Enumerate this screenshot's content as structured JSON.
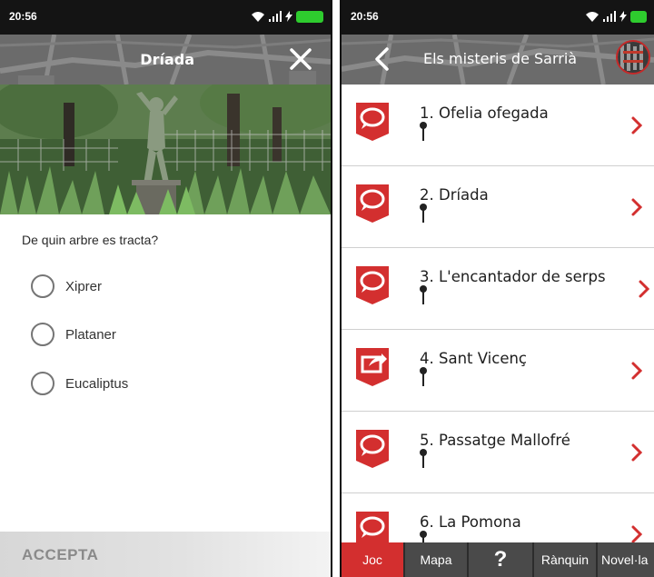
{
  "left_screen": {
    "status_time": "20:56",
    "header_title": "Dríada",
    "close_icon": "close-icon",
    "question": "De quin arbre es tracta?",
    "options": [
      "Xiprer",
      "Plataner",
      "Eucaliptus"
    ],
    "accept_label": "ACCEPTA"
  },
  "right_screen": {
    "status_time": "20:56",
    "header_title": "Els misteris de Sarrià",
    "back_icon": "back-arrow-icon",
    "items": [
      {
        "title": "1. Ofelia ofegada",
        "icon": "speech-bubble-icon"
      },
      {
        "title": "2. Dríada",
        "icon": "speech-bubble-icon"
      },
      {
        "title": "3. L'encantador de serps",
        "icon": "speech-bubble-icon"
      },
      {
        "title": "4. Sant Vicenç",
        "icon": "share-icon"
      },
      {
        "title": "5. Passatge Mallofré",
        "icon": "speech-bubble-icon"
      },
      {
        "title": "6. La Pomona",
        "icon": "speech-bubble-icon"
      }
    ],
    "tabs": [
      {
        "label": "Joc",
        "active": true
      },
      {
        "label": "Mapa",
        "active": false
      },
      {
        "label": "?",
        "active": false
      },
      {
        "label": "Rànquin",
        "active": false
      },
      {
        "label": "Novel·la",
        "active": false
      }
    ]
  },
  "colors": {
    "accent_red": "#d32f2f",
    "header_gray": "#6e6e6e",
    "status_bar": "#141414",
    "battery_green": "#2ecc2e",
    "tabbar_gray": "#4a4a4a"
  }
}
